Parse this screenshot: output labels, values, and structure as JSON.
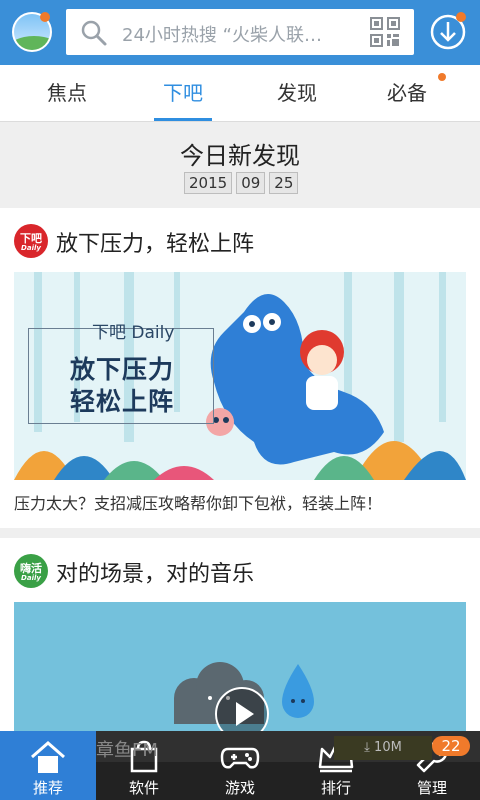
{
  "search": {
    "placeholder": "24小时热搜 “火柴人联…"
  },
  "tabs": [
    {
      "label": "焦点"
    },
    {
      "label": "下吧"
    },
    {
      "label": "发现"
    },
    {
      "label": "必备"
    }
  ],
  "section": {
    "title": "今日新发现",
    "date": [
      "2015",
      "09",
      "25"
    ]
  },
  "cards": [
    {
      "logo_text": "下吧",
      "logo_sub": "Daily",
      "title": "放下压力，轻松上阵",
      "banner": {
        "tag": "下吧 Daily",
        "line1": "放下压力",
        "line2": "轻松上阵"
      },
      "caption": "压力太大？支招减压攻略帮你卸下包袱，轻装上阵！"
    },
    {
      "logo_text": "嗨活",
      "logo_sub": "Daily",
      "title": "对的场景，对的音乐"
    }
  ],
  "peek": {
    "app_name": "章鱼FM",
    "download": "⤓ 10M"
  },
  "bottom_nav": [
    {
      "label": "推荐",
      "icon": "home-icon"
    },
    {
      "label": "软件",
      "icon": "bag-icon"
    },
    {
      "label": "游戏",
      "icon": "gamepad-icon"
    },
    {
      "label": "排行",
      "icon": "crown-icon"
    },
    {
      "label": "管理",
      "icon": "wrench-icon"
    }
  ],
  "manage_badge": "22",
  "colors": {
    "primary": "#3a8fd8",
    "accent": "#f07a2b",
    "tab_active": "#2f8ee0"
  }
}
